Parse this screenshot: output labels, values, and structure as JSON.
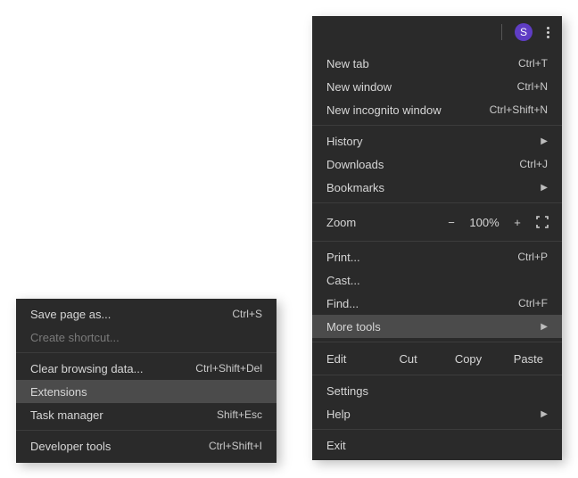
{
  "topbar": {
    "avatar_letter": "S",
    "avatar_bg": "#5f3dc4"
  },
  "main": {
    "new_tab": {
      "label": "New tab",
      "shortcut": "Ctrl+T"
    },
    "new_window": {
      "label": "New window",
      "shortcut": "Ctrl+N"
    },
    "new_incognito": {
      "label": "New incognito window",
      "shortcut": "Ctrl+Shift+N"
    },
    "history": {
      "label": "History"
    },
    "downloads": {
      "label": "Downloads",
      "shortcut": "Ctrl+J"
    },
    "bookmarks": {
      "label": "Bookmarks"
    },
    "zoom": {
      "label": "Zoom",
      "minus": "−",
      "value": "100%",
      "plus": "+"
    },
    "print": {
      "label": "Print...",
      "shortcut": "Ctrl+P"
    },
    "cast": {
      "label": "Cast..."
    },
    "find": {
      "label": "Find...",
      "shortcut": "Ctrl+F"
    },
    "more_tools": {
      "label": "More tools"
    },
    "edit": {
      "label": "Edit",
      "cut": "Cut",
      "copy": "Copy",
      "paste": "Paste"
    },
    "settings": {
      "label": "Settings"
    },
    "help": {
      "label": "Help"
    },
    "exit": {
      "label": "Exit"
    }
  },
  "sub": {
    "save_page": {
      "label": "Save page as...",
      "shortcut": "Ctrl+S"
    },
    "create_shortcut": {
      "label": "Create shortcut..."
    },
    "clear_data": {
      "label": "Clear browsing data...",
      "shortcut": "Ctrl+Shift+Del"
    },
    "extensions": {
      "label": "Extensions"
    },
    "task_manager": {
      "label": "Task manager",
      "shortcut": "Shift+Esc"
    },
    "dev_tools": {
      "label": "Developer tools",
      "shortcut": "Ctrl+Shift+I"
    }
  }
}
